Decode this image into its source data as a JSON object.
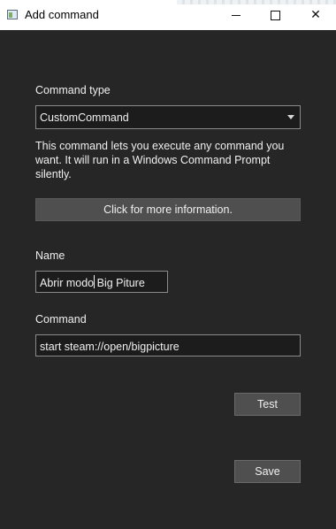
{
  "window": {
    "title": "Add command",
    "minimize_icon": "minimize-icon",
    "maximize_icon": "maximize-icon",
    "close_icon": "close-icon",
    "close_glyph": "✕"
  },
  "form": {
    "command_type": {
      "label": "Command type",
      "selected": "CustomCommand"
    },
    "description": "This command lets you execute any command you want. It will run in a Windows Command Prompt silently.",
    "info_button": "Click for more information.",
    "name": {
      "label": "Name",
      "value": "Abrir modo Big Piture"
    },
    "command": {
      "label": "Command",
      "value": "start steam://open/bigpicture"
    },
    "test_button": "Test",
    "save_button": "Save"
  },
  "colors": {
    "background": "#262626",
    "titlebar": "#ffffff",
    "button": "#4f4f4f",
    "input_border": "#8a8a8a"
  }
}
